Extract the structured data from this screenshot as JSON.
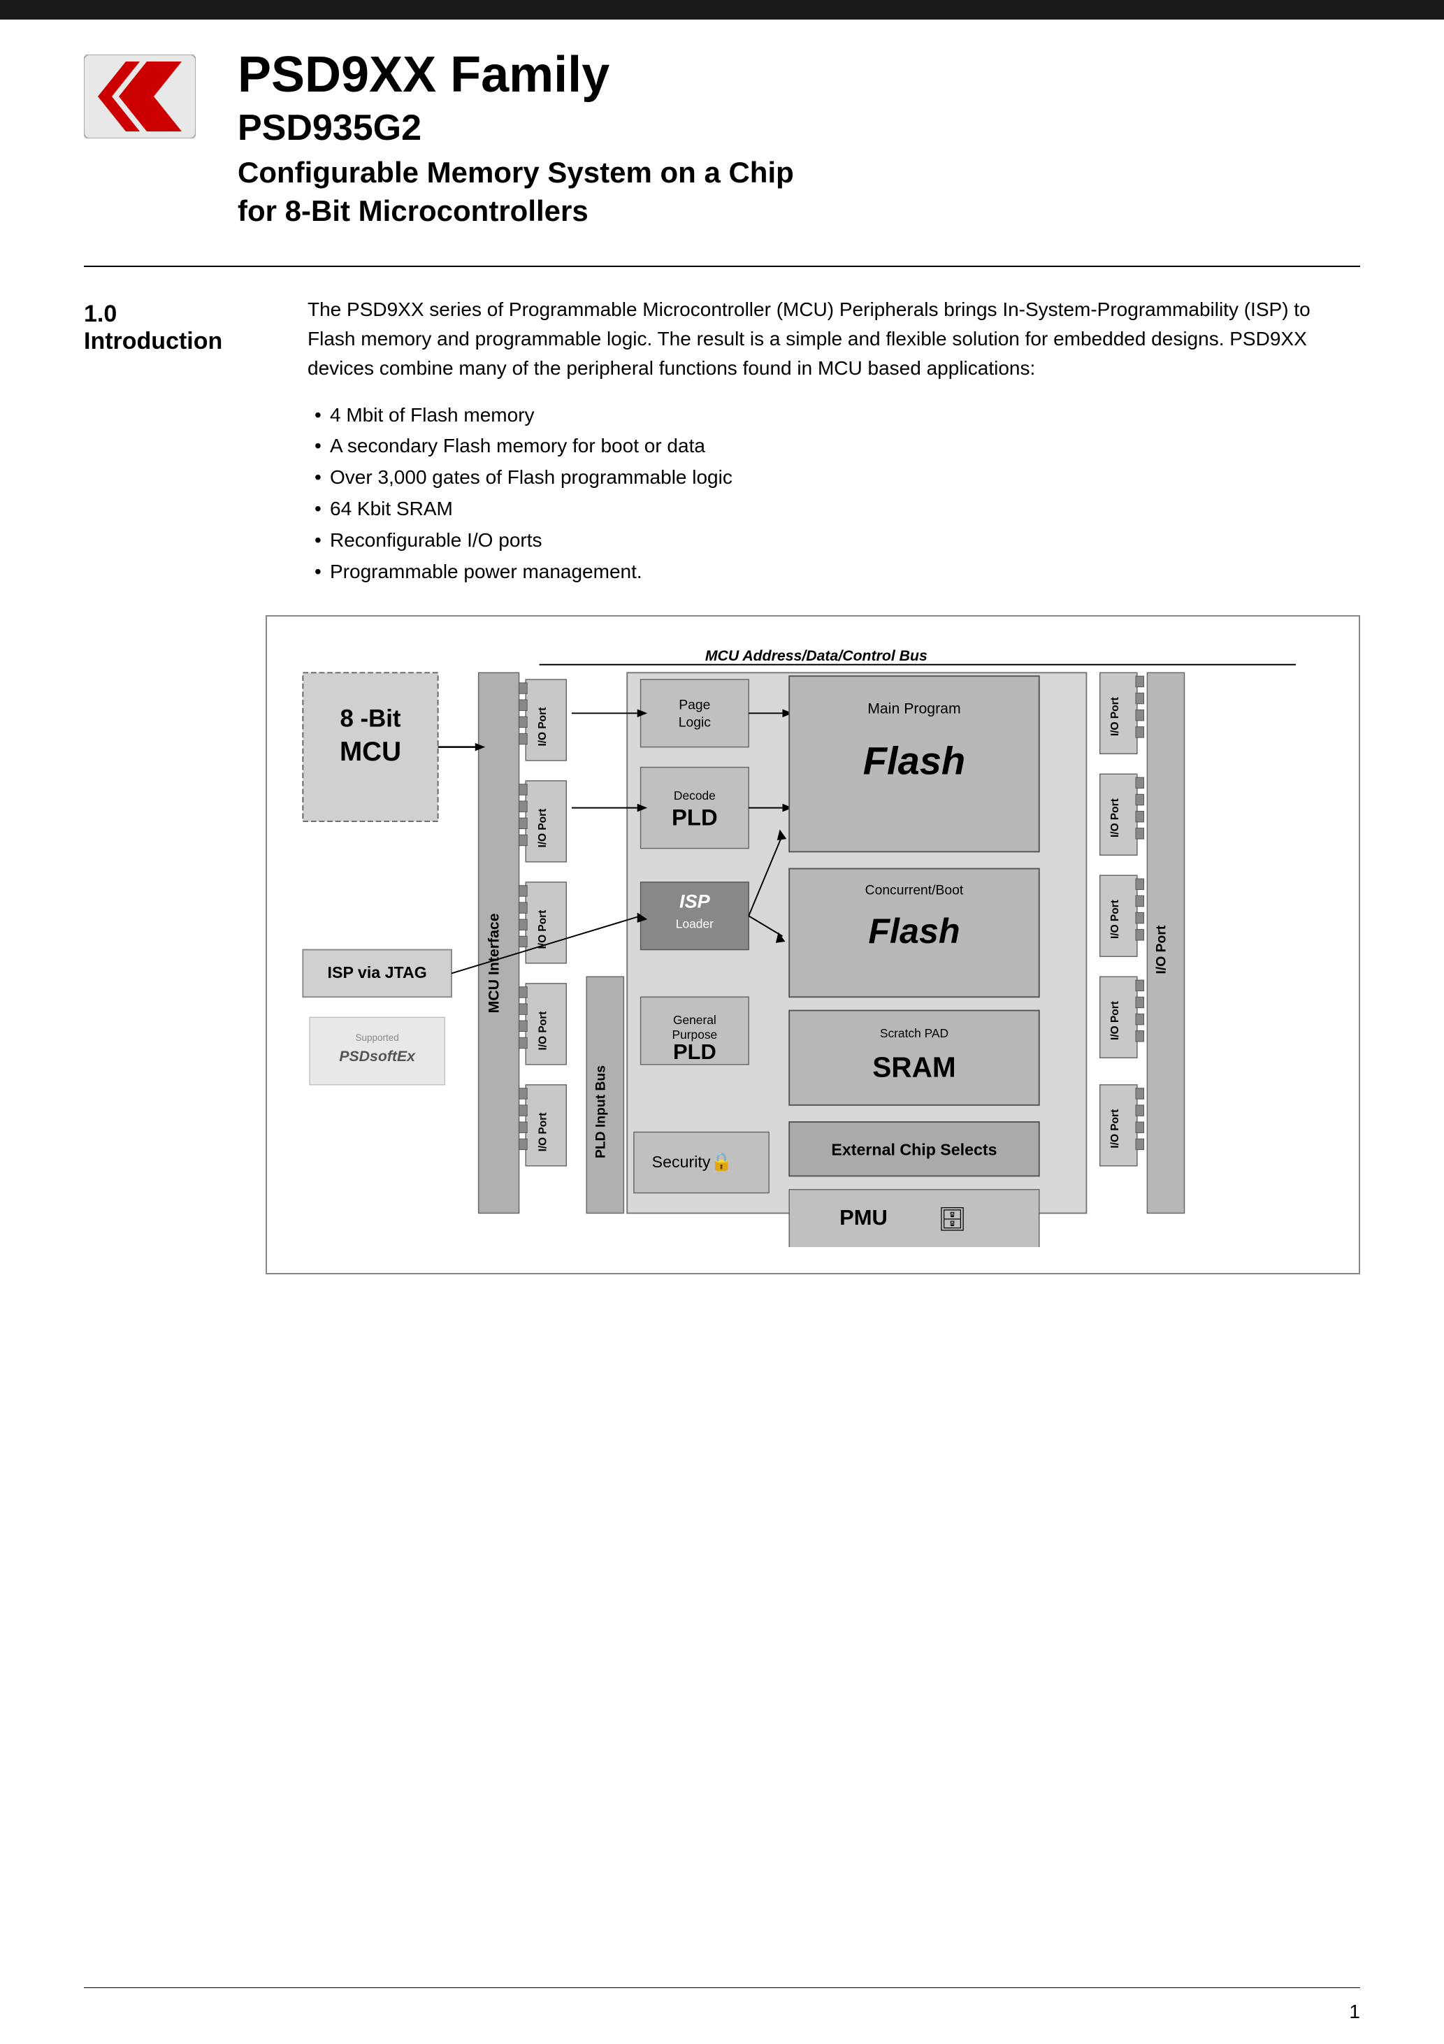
{
  "header": {
    "bar_color": "#1a1a1a",
    "product_family": "PSD9XX Family",
    "product_model": "PSD935G2",
    "product_desc_line1": "Configurable Memory System on a Chip",
    "product_desc_line2": "for 8-Bit Microcontrollers"
  },
  "section": {
    "number": "1.0",
    "title": "Introduction"
  },
  "intro": {
    "paragraph": "The PSD9XX series of Programmable Microcontroller (MCU) Peripherals brings In-System-Programmability (ISP) to Flash memory and programmable logic. The result is a simple and flexible solution for embedded designs. PSD9XX devices combine many of the peripheral functions found in MCU based applications:"
  },
  "bullets": [
    "4 Mbit of Flash memory",
    "A secondary Flash memory for boot or data",
    "Over 3,000 gates of Flash programmable logic",
    "64 Kbit SRAM",
    "Reconfigurable I/O ports",
    "Programmable power management."
  ],
  "diagram": {
    "title": "MCU Address/Data/Control Bus",
    "mcu_label": "8 -Bit\nMCU",
    "mcu_interface": "MCU Interface",
    "isp_jtag": "ISP via JTAG",
    "isp_loader": "ISP\nLoader",
    "page_logic": "Page\nLogic",
    "decode": "Decode",
    "pld_decode": "PLD",
    "main_program": "Main Program",
    "main_flash": "Flash",
    "concurrent_boot": "Concurrent/Boot",
    "boot_flash": "Flash",
    "scratch_pad": "Scratch PAD",
    "sram": "SRAM",
    "general_purpose": "General\nPurpose",
    "pld_gp": "PLD",
    "external_chip_selects": "External Chip Selects",
    "security": "Security",
    "pmu": "PMU",
    "pld_input_bus": "PLD Input Bus",
    "io_port": "I/O Port",
    "supported_label": "Supported"
  },
  "footer": {
    "page_number": "1"
  }
}
